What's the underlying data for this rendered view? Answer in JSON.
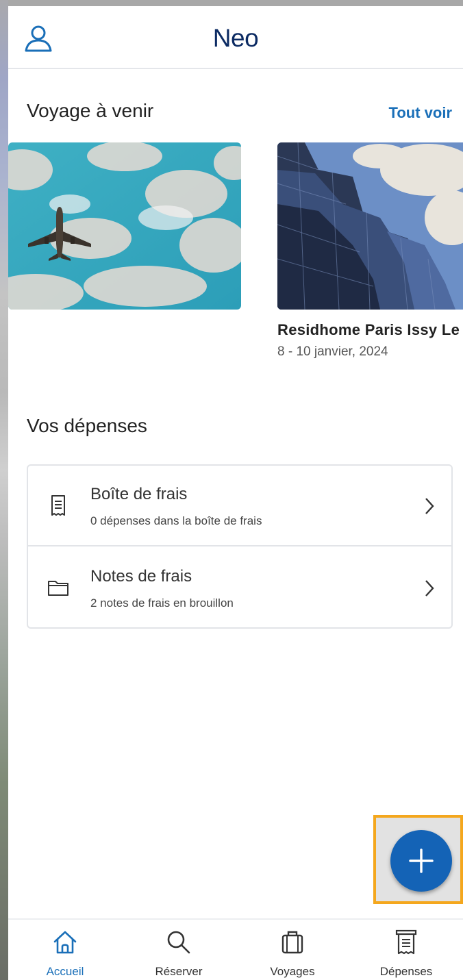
{
  "header": {
    "title": "Neo"
  },
  "upcoming": {
    "title": "Voyage à venir",
    "see_all": "Tout voir",
    "trip": {
      "name": "Residhome Paris Issy Le",
      "dates": "8 - 10 janvier, 2024"
    }
  },
  "expenses": {
    "title": "Vos dépenses",
    "items": [
      {
        "label": "Boîte de frais",
        "sub": "0 dépenses dans la boîte de frais",
        "icon": "receipt-icon"
      },
      {
        "label": "Notes de frais",
        "sub": "2 notes de frais en brouillon",
        "icon": "folder-icon"
      }
    ]
  },
  "fab": {
    "icon": "plus-icon"
  },
  "tabs": [
    {
      "label": "Accueil",
      "icon": "home-icon",
      "active": true
    },
    {
      "label": "Réserver",
      "icon": "search-icon",
      "active": false
    },
    {
      "label": "Voyages",
      "icon": "suitcase-icon",
      "active": false
    },
    {
      "label": "Dépenses",
      "icon": "receipt-icon",
      "active": false
    }
  ],
  "colors": {
    "brand": "#0c2b63",
    "accent": "#1a6fb8",
    "fab": "#1463b6",
    "highlight": "#f4a71d"
  }
}
